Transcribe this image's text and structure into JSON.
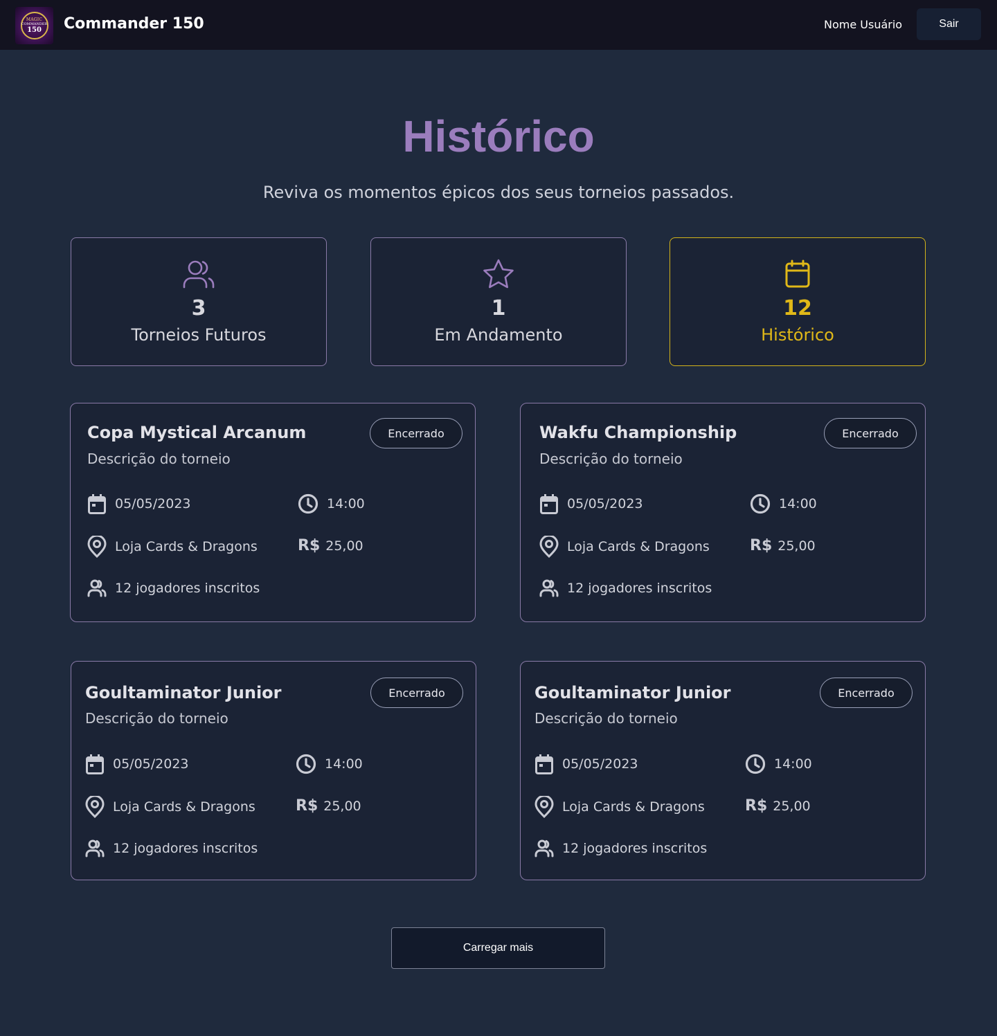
{
  "header": {
    "app_title": "Commander 150",
    "logo_text": [
      "MAGIC",
      "COMMANDER",
      "150"
    ],
    "user_name": "Nome Usuário",
    "logout_label": "Sair"
  },
  "hero": {
    "title": "Histórico",
    "subtitle": "Reviva os momentos épicos dos seus torneios passados."
  },
  "stats": [
    {
      "icon": "users-icon",
      "value": "3",
      "label": "Torneios Futuros",
      "active": false
    },
    {
      "icon": "star-icon",
      "value": "1",
      "label": "Em Andamento",
      "active": false
    },
    {
      "icon": "calendar-icon",
      "value": "12",
      "label": "Histórico",
      "active": true
    }
  ],
  "cards": [
    {
      "title": "Copa Mystical Arcanum",
      "description": "Descrição do torneio",
      "status": "Encerrado",
      "date": "05/05/2023",
      "time": "14:00",
      "location": "Loja Cards & Dragons",
      "currency": "R$",
      "price": "25,00",
      "players": "12 jogadores inscritos"
    },
    {
      "title": "Wakfu Championship",
      "description": "Descrição do torneio",
      "status": "Encerrado",
      "date": "05/05/2023",
      "time": "14:00",
      "location": "Loja Cards & Dragons",
      "currency": "R$",
      "price": "25,00",
      "players": "12 jogadores inscritos"
    },
    {
      "title": "Goultaminator Junior",
      "description": "Descrição do torneio",
      "status": "Encerrado",
      "date": "05/05/2023",
      "time": "14:00",
      "location": "Loja Cards & Dragons",
      "currency": "R$",
      "price": "25,00",
      "players": "12 jogadores inscritos"
    },
    {
      "title": "Goultaminator Junior",
      "description": "Descrição do torneio",
      "status": "Encerrado",
      "date": "05/05/2023",
      "time": "14:00",
      "location": "Loja Cards & Dragons",
      "currency": "R$",
      "price": "25,00",
      "players": "12 jogadores inscritos"
    }
  ],
  "load_more_label": "Carregar mais",
  "colors": {
    "accent_purple": "#9b7dbd",
    "accent_gold": "#e0b818",
    "background": "#1f2a3d",
    "header_bg": "#131320"
  }
}
